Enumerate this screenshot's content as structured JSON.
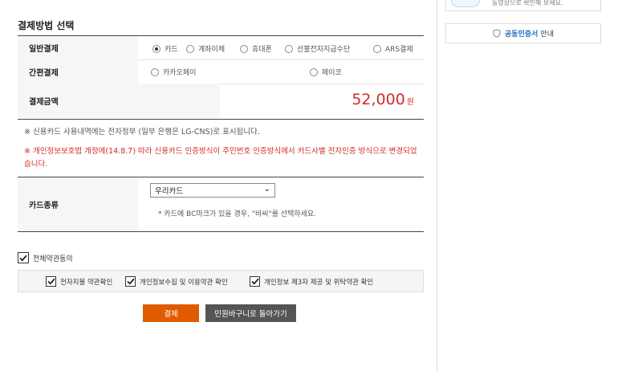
{
  "section_title": "결제방법 선택",
  "payment": {
    "general_label": "일반결제",
    "general_options": [
      {
        "label": "카드",
        "selected": true
      },
      {
        "label": "계좌이체",
        "selected": false
      },
      {
        "label": "휴대폰",
        "selected": false
      },
      {
        "label": "선불전자지급수단",
        "selected": false
      },
      {
        "label": "ARS결제",
        "selected": false
      }
    ],
    "simple_label": "간편결제",
    "simple_options": [
      {
        "label": "카카오페이",
        "selected": false
      },
      {
        "label": "페이코",
        "selected": false
      }
    ],
    "amount_label": "결제금액",
    "amount_value": "52,000",
    "amount_unit": "원"
  },
  "notes": {
    "statement": "※ 신용카드 사용내역에는 전자정부 (일부 은행은 LG-CNS)로 표시됩니다.",
    "privacy": "※ 개인정보보호법 개정에(14.8.7) 따라 신용카드 인증방식이 주민번호 인증방식에서 카드사별 전자인증 방식으로 변경되었습니다."
  },
  "card": {
    "label": "카드종류",
    "selected": "우리카드",
    "note": "* 카드에 BC마크가 있을 경우, \"비씨\"를 선택하세요."
  },
  "agreements": {
    "all_label": "전체약관동의",
    "items": [
      {
        "label": "전자지불 약관확인",
        "checked": true
      },
      {
        "label": "개인정보수집 및 이용약관 확인",
        "checked": true
      },
      {
        "label": "개인정보 제3자 제공 및 위탁약관 확인",
        "checked": true
      }
    ]
  },
  "buttons": {
    "pay": "결제",
    "back": "민원바구니로 돌아가기"
  },
  "sidebar": {
    "top_text": "동영상으로 확인해 보세요.",
    "cert_emphasis": "공동인증서",
    "cert_text": "안내"
  },
  "colors": {
    "amount": "#d42a2a",
    "pay_button": "#e05a00",
    "back_button": "#555555",
    "link": "#1f6fc0"
  }
}
